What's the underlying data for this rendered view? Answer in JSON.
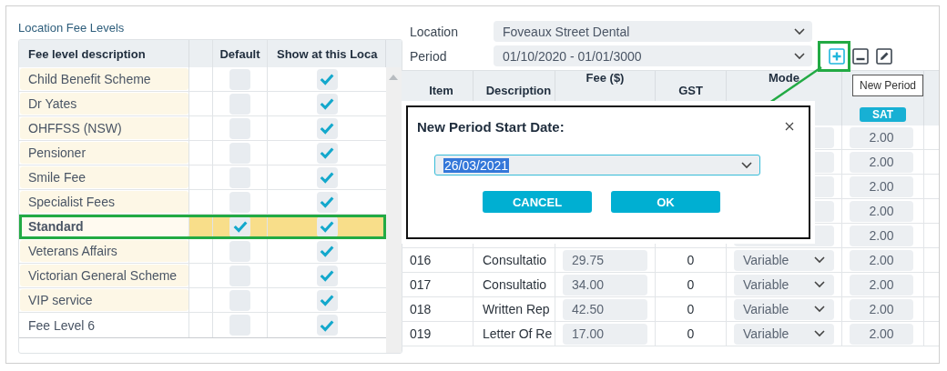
{
  "left_panel": {
    "title": "Location Fee Levels",
    "columns": [
      "Fee level description",
      "Default",
      "Show at this Loca"
    ],
    "rows": [
      {
        "description": "Child Benefit Scheme",
        "shaded": true,
        "default": false,
        "show": true,
        "selected": false
      },
      {
        "description": "Dr Yates",
        "shaded": true,
        "default": false,
        "show": true,
        "selected": false
      },
      {
        "description": "OHFFSS (NSW)",
        "shaded": true,
        "default": false,
        "show": true,
        "selected": false
      },
      {
        "description": "Pensioner",
        "shaded": true,
        "default": false,
        "show": true,
        "selected": false
      },
      {
        "description": "Smile Fee",
        "shaded": true,
        "default": false,
        "show": true,
        "selected": false
      },
      {
        "description": "Specialist Fees",
        "shaded": true,
        "default": false,
        "show": true,
        "selected": false
      },
      {
        "description": "Standard",
        "shaded": true,
        "default": true,
        "show": true,
        "selected": true
      },
      {
        "description": "Veterans Affairs",
        "shaded": true,
        "default": false,
        "show": true,
        "selected": false
      },
      {
        "description": "Victorian General Scheme",
        "shaded": true,
        "default": false,
        "show": true,
        "selected": false
      },
      {
        "description": "VIP service",
        "shaded": true,
        "default": false,
        "show": true,
        "selected": false
      },
      {
        "description": "Fee Level 6",
        "shaded": false,
        "default": false,
        "show": true,
        "selected": false
      }
    ]
  },
  "location": {
    "label": "Location",
    "value": "Foveaux Street Dental"
  },
  "period": {
    "label": "Period",
    "value": "01/10/2020 - 01/01/3000"
  },
  "tooltip": "New Period",
  "grid": {
    "columns": [
      "Item",
      "Description",
      "Fee ($)",
      "GST",
      "Mode"
    ],
    "day_badge": "SAT",
    "rows": [
      {
        "sat": "2.00"
      },
      {
        "sat": "2.00"
      },
      {
        "sat": "2.00"
      },
      {
        "sat": "2.00"
      },
      {
        "sat": "2.00"
      },
      {
        "item": "016",
        "description": "Consultatio",
        "fee": "29.75",
        "gst": "0",
        "mode": "Variable",
        "sat": "2.00"
      },
      {
        "item": "017",
        "description": "Consultatio",
        "fee": "34.00",
        "gst": "0",
        "mode": "Variable",
        "sat": "2.00"
      },
      {
        "item": "018",
        "description": "Written Rep",
        "fee": "42.50",
        "gst": "0",
        "mode": "Variable",
        "sat": "2.00"
      },
      {
        "item": "019",
        "description": "Letter Of Re",
        "fee": "17.00",
        "gst": "0",
        "mode": "Variable",
        "sat": "2.00"
      }
    ]
  },
  "dialog": {
    "title": "New Period Start Date:",
    "date": "26/03/2021",
    "buttons": [
      "CANCEL",
      "OK"
    ]
  }
}
